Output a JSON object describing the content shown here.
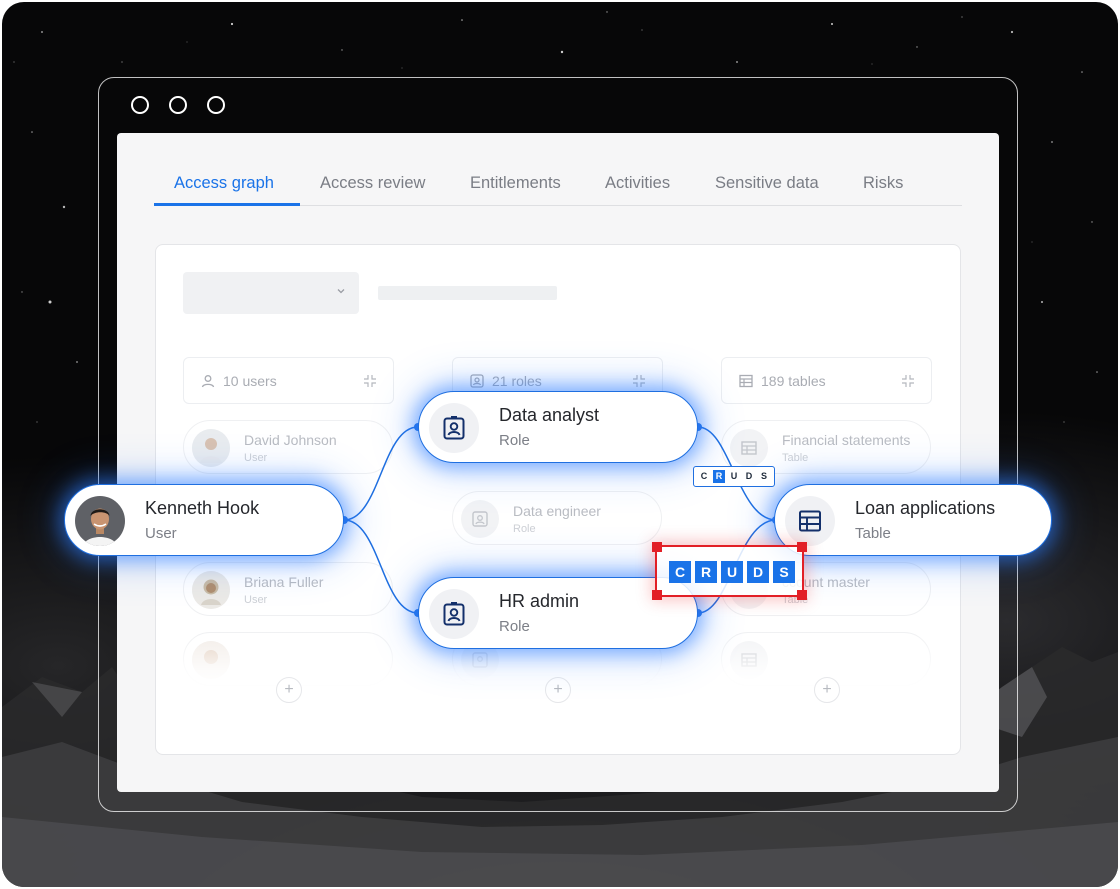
{
  "tabs": [
    {
      "label": "Access graph",
      "active": true
    },
    {
      "label": "Access review"
    },
    {
      "label": "Entitlements"
    },
    {
      "label": "Activities"
    },
    {
      "label": "Sensitive data"
    },
    {
      "label": "Risks"
    }
  ],
  "columns": {
    "users": {
      "label": "10 users",
      "icon": "user-icon"
    },
    "roles": {
      "label": "21 roles",
      "icon": "role-badge-icon"
    },
    "tables": {
      "label": "189 tables",
      "icon": "table-icon"
    }
  },
  "background_items": {
    "user1": {
      "name": "David Johnson",
      "type": "User"
    },
    "user2": {
      "name": "Briana Fuller",
      "type": "User"
    },
    "role1": {
      "name": "Data engineer",
      "type": "Role"
    },
    "table1": {
      "name": "Financial statements",
      "type": "Table"
    },
    "table2": {
      "name": "ccount master",
      "type": "Table"
    }
  },
  "nodes": {
    "kenneth": {
      "name": "Kenneth Hook",
      "type": "User"
    },
    "data_analyst": {
      "name": "Data analyst",
      "type": "Role"
    },
    "hr_admin": {
      "name": "HR admin",
      "type": "Role"
    },
    "loan": {
      "name": "Loan applications",
      "type": "Table"
    }
  },
  "permissions_small": {
    "letters": [
      "C",
      "R",
      "U",
      "D",
      "S"
    ],
    "active": [
      "R"
    ]
  },
  "permissions_big": {
    "letters": [
      "C",
      "R",
      "U",
      "D",
      "S"
    ],
    "active": [
      "C",
      "R",
      "U",
      "D",
      "S"
    ]
  },
  "plus_symbol": "+",
  "colors": {
    "accent": "#1a73e8",
    "highlight": "#e21f26",
    "glow": "#2d7dff"
  }
}
